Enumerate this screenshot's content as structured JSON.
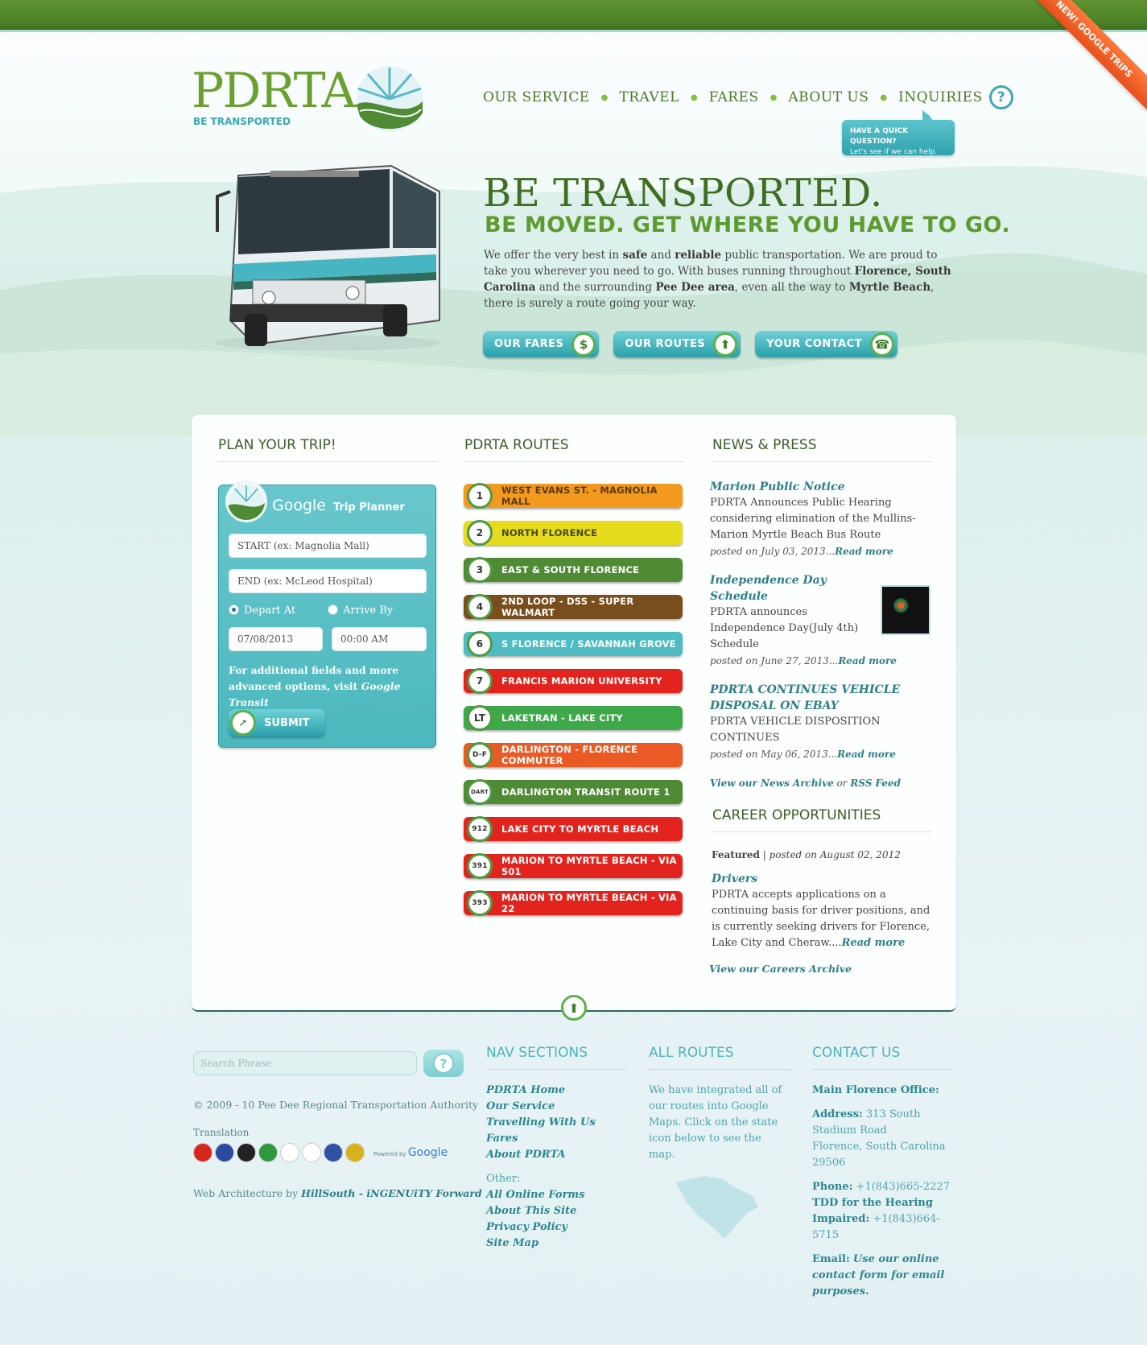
{
  "ribbon": "NEW! GOOGLE TRIPS",
  "logo": {
    "name": "PDRTA",
    "tagline": "BE TRANSPORTED"
  },
  "nav": [
    "OUR SERVICE",
    "TRAVEL",
    "FARES",
    "ABOUT US",
    "INQUIRIES"
  ],
  "quick_question": {
    "line1": "HAVE A QUICK QUESTION?",
    "line2": "Let's see if we can help."
  },
  "hero": {
    "title": "BE TRANSPORTED.",
    "subtitle": "BE MOVED. GET WHERE YOU HAVE TO GO.",
    "body": [
      {
        "t": "We offer the very best in "
      },
      {
        "t": "safe",
        "b": true
      },
      {
        "t": " and "
      },
      {
        "t": "reliable",
        "b": true
      },
      {
        "t": " public transportation. We are proud to take you wherever you need to go. With buses running throughout "
      },
      {
        "t": "Florence, South Carolina",
        "b": true
      },
      {
        "t": " and the surrounding "
      },
      {
        "t": "Pee Dee area",
        "b": true
      },
      {
        "t": ", even all the way to "
      },
      {
        "t": "Myrtle Beach",
        "b": true
      },
      {
        "t": ", there is surely a route going your way."
      }
    ],
    "buttons": [
      {
        "label": "OUR FARES",
        "icon": "$"
      },
      {
        "label": "OUR ROUTES",
        "icon": "⬆"
      },
      {
        "label": "YOUR CONTACT",
        "icon": "☎"
      }
    ]
  },
  "columns": {
    "plan": "PLAN YOUR TRIP!",
    "routes": "PDRTA ROUTES",
    "news": "NEWS & PRESS",
    "career": "CAREER OPPORTUNITIES"
  },
  "trip": {
    "google": "Google",
    "planner": "Trip Planner",
    "start_placeholder": "START (ex: Magnolia Mall)",
    "end_placeholder": "END (ex: McLeod Hospital)",
    "depart": "Depart At",
    "arrive": "Arrive By",
    "date": "07/08/2013",
    "time": "00:00 AM",
    "note_pre": "For additional fields and more advanced options, visit ",
    "note_link": "Google Transit",
    "submit": "SUBMIT"
  },
  "routes": [
    {
      "num": "1",
      "name": "WEST EVANS ST. - MAGNOLIA MALL",
      "color": "#f39a1e",
      "text": "#5a3a0a"
    },
    {
      "num": "2",
      "name": "NORTH FLORENCE",
      "color": "#e6dc1d",
      "text": "#4a4a0a"
    },
    {
      "num": "3",
      "name": "EAST & SOUTH FLORENCE",
      "color": "#4f8a34",
      "text": "#ffffff"
    },
    {
      "num": "4",
      "name": "2ND LOOP - DSS - SUPER WALMART",
      "color": "#7a4e1c",
      "text": "#ffffff"
    },
    {
      "num": "6",
      "name": "S FLORENCE / SAVANNAH GROVE",
      "color": "#4fbcc4",
      "text": "#ffffff"
    },
    {
      "num": "7",
      "name": "FRANCIS MARION UNIVERSITY",
      "color": "#e3241e",
      "text": "#ffffff"
    },
    {
      "num": "LT",
      "name": "LAKETRAN - LAKE CITY",
      "color": "#3fa84a",
      "text": "#ffffff"
    },
    {
      "num": "D-F",
      "name": "DARLINGTON - FLORENCE COMMUTER",
      "color": "#ea5a25",
      "text": "#ffffff"
    },
    {
      "num": "DART",
      "name": "DARLINGTON TRANSIT ROUTE 1",
      "color": "#4f8a34",
      "text": "#ffffff"
    },
    {
      "num": "912",
      "name": "LAKE CITY TO MYRTLE BEACH",
      "color": "#e3241e",
      "text": "#ffffff"
    },
    {
      "num": "391",
      "name": "MARION TO MYRTLE BEACH - VIA 501",
      "color": "#e3241e",
      "text": "#ffffff"
    },
    {
      "num": "393",
      "name": "MARION TO MYRTLE BEACH - VIA 22",
      "color": "#e3241e",
      "text": "#ffffff"
    }
  ],
  "news": [
    {
      "title": "Marion Public Notice",
      "body": "PDRTA Announces Public Hearing considering elimination of the Mullins-Marion Myrtle Beach Bus Route",
      "meta": "posted on July 03, 2013...",
      "more": "Read more"
    },
    {
      "title": "Independence Day Schedule",
      "body": "PDRTA announces Independence Day(July 4th) Schedule",
      "meta": "posted on June 27, 2013...",
      "more": "Read more"
    },
    {
      "title": "PDRTA CONTINUES VEHICLE DISPOSAL ON EBAY",
      "body": "PDRTA VEHICLE DISPOSITION CONTINUES",
      "meta": "posted on May 06, 2013...",
      "more": "Read more"
    }
  ],
  "news_footer": {
    "archive": "View our News Archive",
    "or": " or ",
    "rss": "RSS Feed"
  },
  "career": {
    "featured": "Featured",
    "sep": " | ",
    "posted": "posted on August 02, 2012",
    "title": "Drivers",
    "body": "PDRTA accepts applications on a continuing basis for driver positions, and is currently seeking drivers for Florence, Lake City and Cheraw....",
    "more": "Read more",
    "archive": "View our Careers Archive"
  },
  "footer": {
    "search_placeholder": "Search Phrase",
    "copyright": "© 2009 - 10 Pee Dee Regional Transportation Authority",
    "translation": "Translation",
    "powered": "Powered by",
    "google": "Google",
    "arch_pre": "Web Architecture by ",
    "arch_link": "HillSouth - iNGENUiTY Forward",
    "nav_title": "NAV SECTIONS",
    "nav_links": [
      "PDRTA Home",
      "Our Service",
      "Travelling With Us",
      "Fares",
      "About PDRTA"
    ],
    "other_label": "Other:",
    "other_links": [
      "All Online Forms",
      "About This Site",
      "Privacy Policy",
      "Site Map"
    ],
    "routes_title": "ALL ROUTES",
    "routes_text": "We have integrated all of our routes into Google Maps. Click on the state icon below to see the map.",
    "contact_title": "CONTACT US",
    "office": "Main Florence Office:",
    "address_label": "Address:",
    "address_1": " 313 South Stadium Road",
    "address_2": "Florence, South Carolina",
    "address_3": " 29506",
    "phone_label": "Phone:",
    "phone": " +1(843)665-2227",
    "tdd_label": "TDD for the Hearing Impaired:",
    "tdd": " +1(843)664-5715",
    "email_label": "Email:",
    "email": "Use our online contact form for email purposes."
  },
  "flag_colors": [
    "#d7261e",
    "#2b4aa0",
    "#222222",
    "#2e9a3d",
    "#ffffff",
    "#ffffff",
    "#2e53a5",
    "#d8b21e"
  ]
}
